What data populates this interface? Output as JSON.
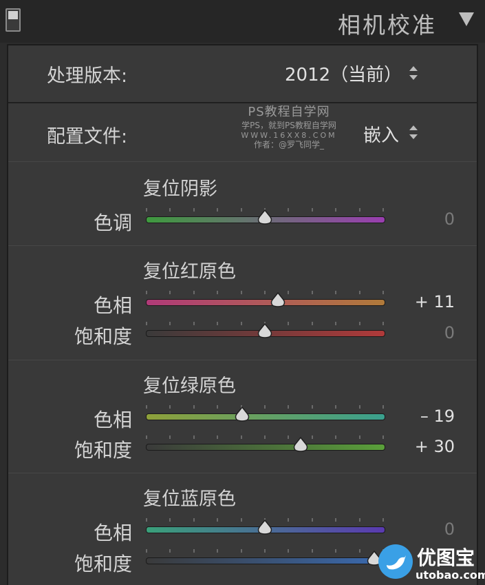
{
  "header": {
    "title": "相机校准"
  },
  "process": {
    "label": "处理版本:",
    "value": "2012（当前）"
  },
  "profile": {
    "label": "配置文件:",
    "value": "嵌入"
  },
  "watermark": {
    "line1": "PS教程自学网",
    "line2": "学PS，就到PS教程自学网",
    "line3": "WWW.16XX8.COM",
    "line4": "作者：@罗飞同学_"
  },
  "shadows": {
    "title": "复位阴影",
    "rows": [
      {
        "label": "色调",
        "value": "0",
        "level": 0.5
      }
    ]
  },
  "red": {
    "title": "复位红原色",
    "rows": [
      {
        "label": "色相",
        "value": "+ 11",
        "level": 0.555
      },
      {
        "label": "饱和度",
        "value": "0",
        "level": 0.5
      }
    ]
  },
  "green": {
    "title": "复位绿原色",
    "rows": [
      {
        "label": "色相",
        "value": "– 19",
        "level": 0.405
      },
      {
        "label": "饱和度",
        "value": "+ 30",
        "level": 0.65
      }
    ]
  },
  "blue": {
    "title": "复位蓝原色",
    "rows": [
      {
        "label": "色相",
        "value": "0",
        "level": 0.5
      },
      {
        "label": "饱和度",
        "value": "",
        "level": 0.96
      }
    ]
  },
  "logo": {
    "name": "优图宝",
    "url": "utobao.com"
  },
  "colors": {
    "shadows_tint": [
      "#3e9a3e",
      "#9a3eb0"
    ],
    "red_hue": [
      "#b03a78",
      "#b07a3a"
    ],
    "red_sat": [
      "#3a3a3a",
      "#b03a3a"
    ],
    "green_hue": [
      "#8ea03a",
      "#3aa08e"
    ],
    "green_sat": [
      "#3a3a3a",
      "#5aa03a"
    ],
    "blue_hue": [
      "#3aa07a",
      "#5a3ab0"
    ],
    "blue_sat": [
      "#3a3a3a",
      "#3a6ab0"
    ]
  }
}
